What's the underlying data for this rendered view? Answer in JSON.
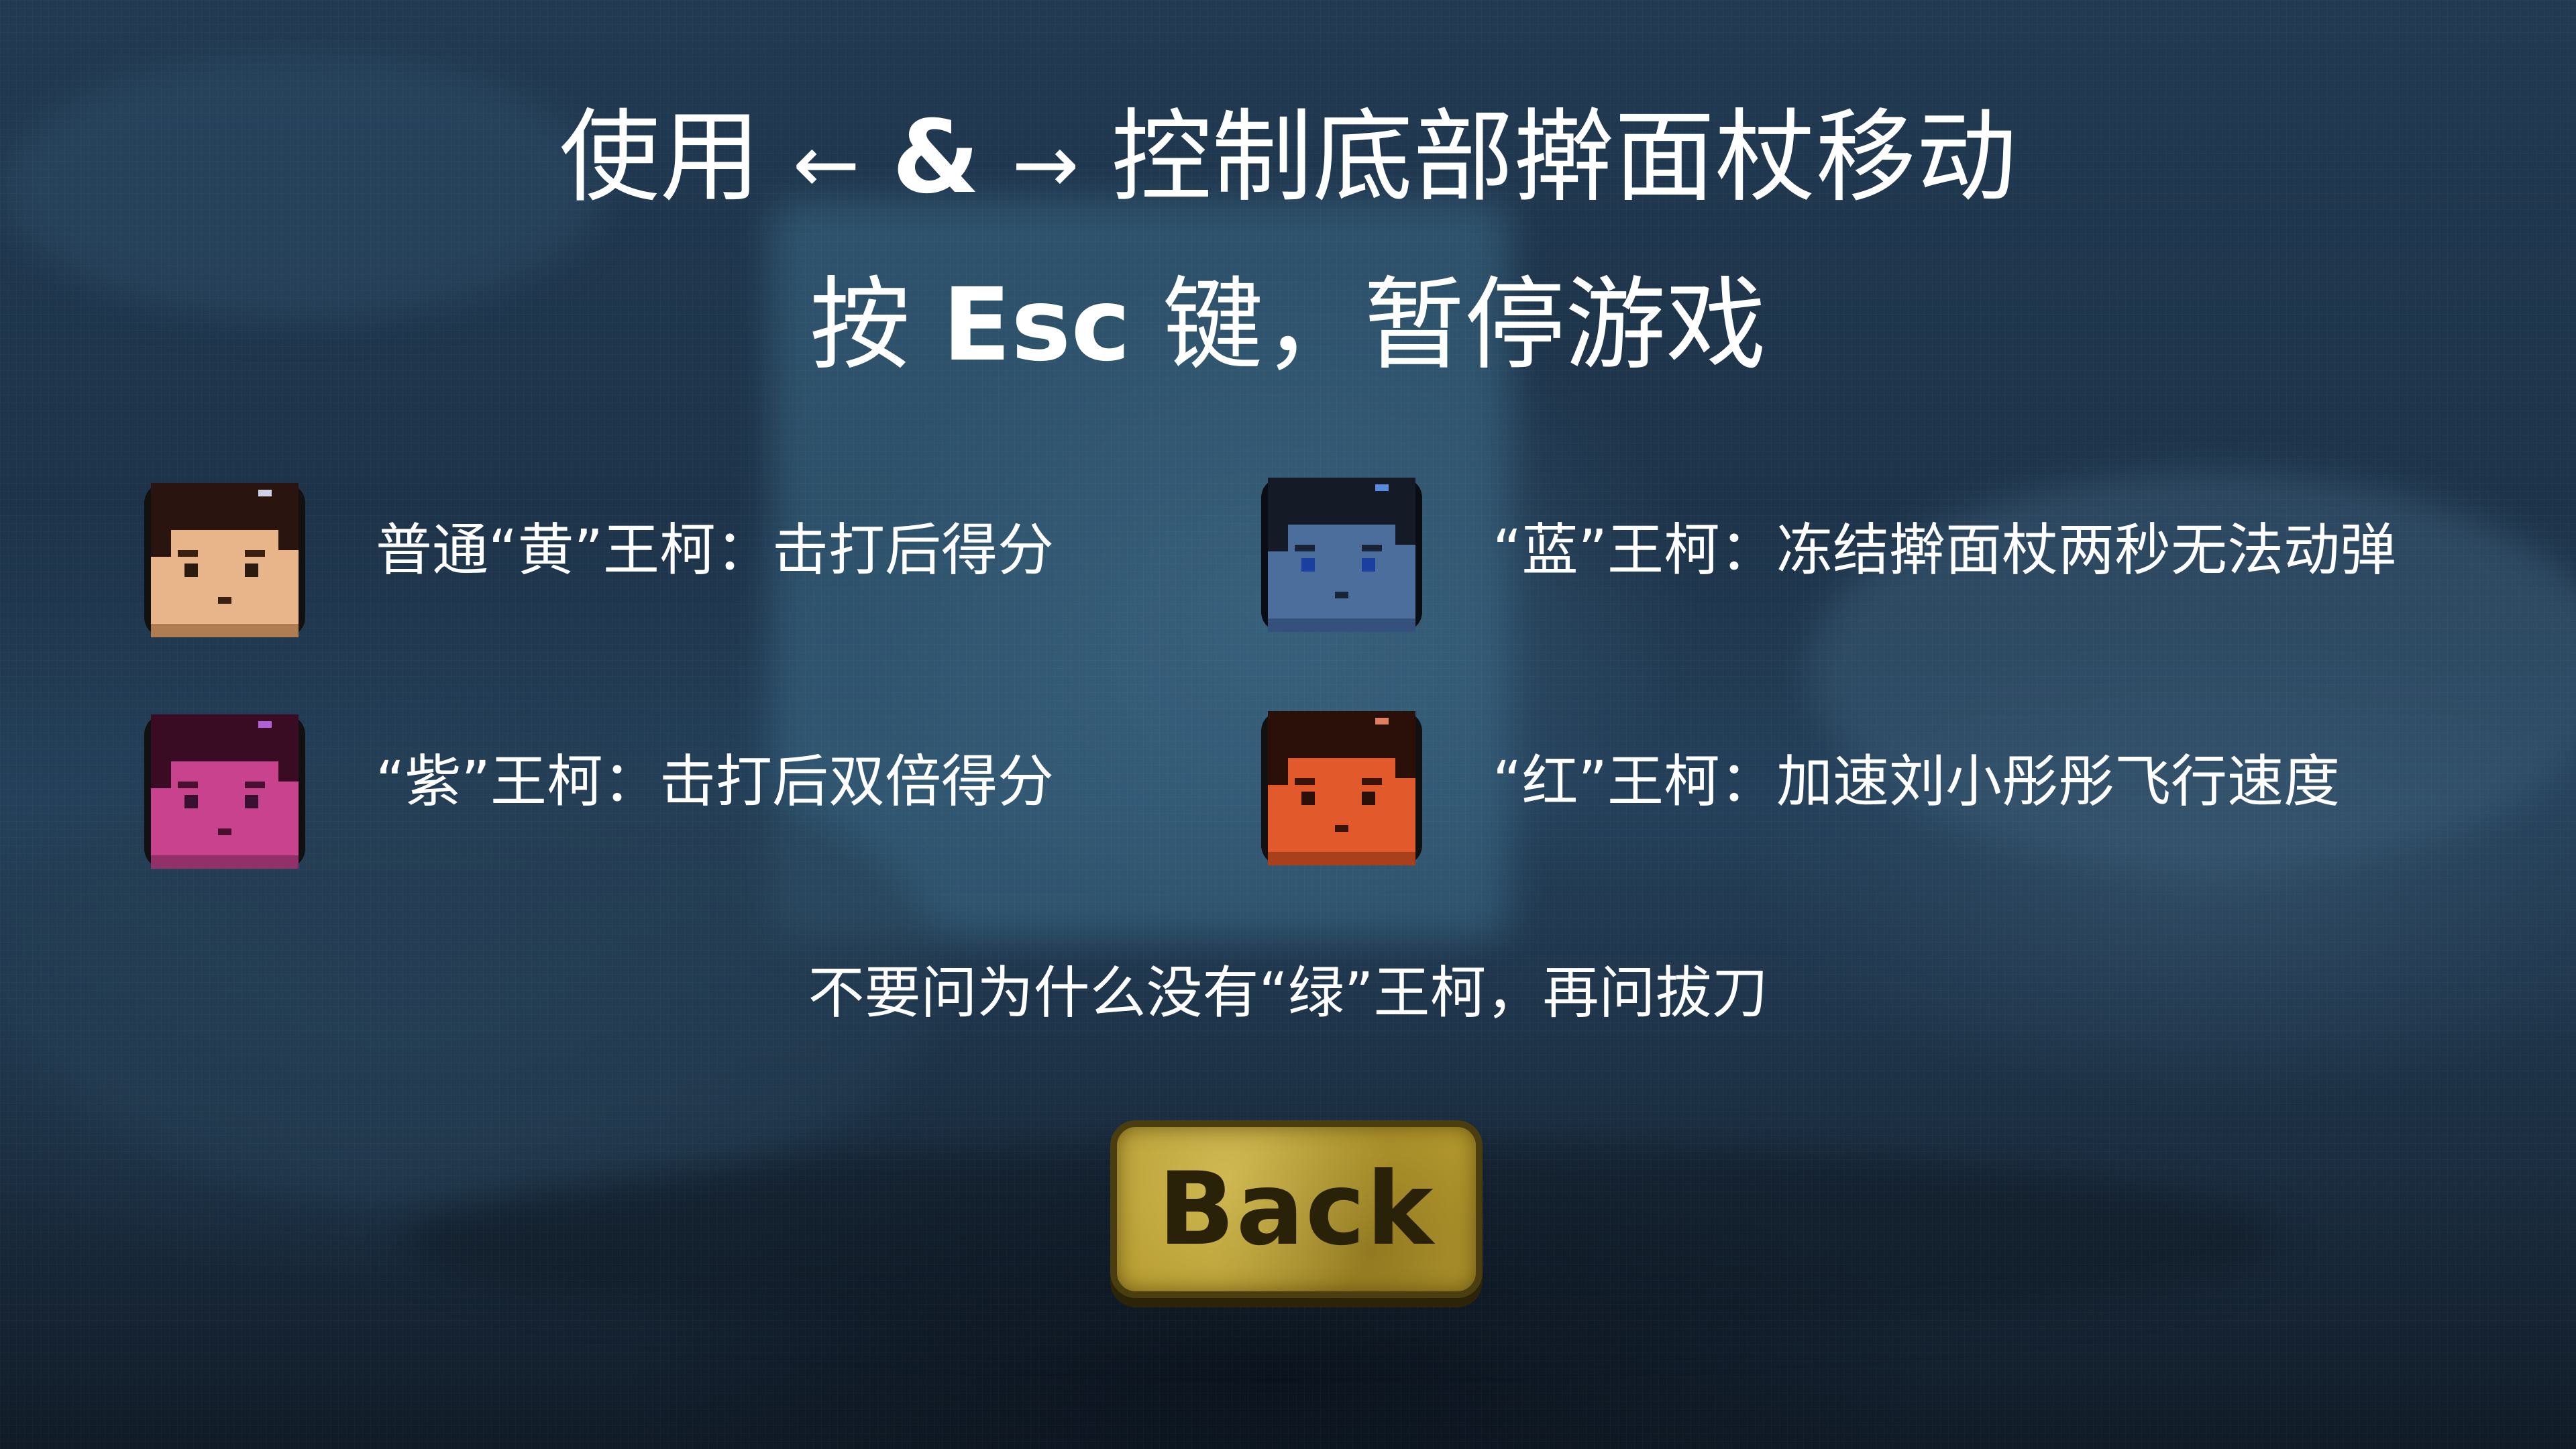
{
  "instructions": {
    "line1_prefix": "使用",
    "left_arrow": "←",
    "amp": "&",
    "right_arrow": "→",
    "line1_suffix": "控制底部擀面杖移动",
    "line2_prefix": "按",
    "esc_key": "Esc",
    "line2_suffix": "键，暂停游戏"
  },
  "enemies": [
    {
      "face_color": "#e8b48a",
      "hair_color": "#2a1410",
      "eye_color": "#2a1a10",
      "text": "普通“黄”王柯：击打后得分"
    },
    {
      "face_color": "#4b6e9c",
      "hair_color": "#141a26",
      "eye_color": "#1a3fa0",
      "text": "“蓝”王柯：冻结擀面杖两秒无法动弹"
    },
    {
      "face_color": "#c8428e",
      "hair_color": "#3a0c24",
      "eye_color": "#3a1030",
      "text": "“紫”王柯：击打后双倍得分"
    },
    {
      "face_color": "#e25a2c",
      "hair_color": "#2a1008",
      "eye_color": "#2a1008",
      "text": "“红”王柯：加速刘小彤彤飞行速度"
    }
  ],
  "footnote": "不要问为什么没有“绿”王柯，再问拔刀",
  "back_button": {
    "label": "Back"
  }
}
